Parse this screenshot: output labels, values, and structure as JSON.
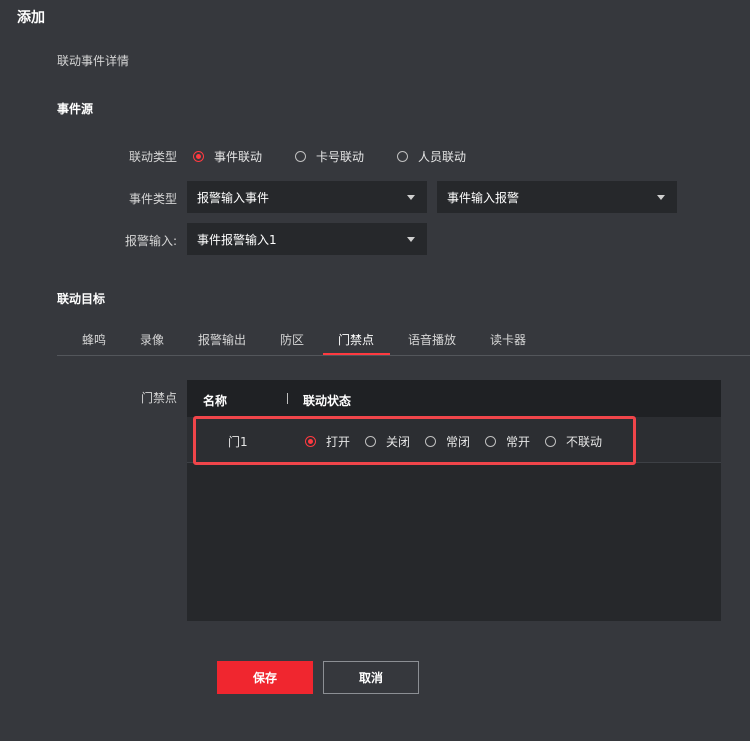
{
  "window": {
    "title": "添加",
    "subtitle": "联动事件详情"
  },
  "event_source": {
    "title": "事件源",
    "linkage_type": {
      "label": "联动类型",
      "options": [
        "事件联动",
        "卡号联动",
        "人员联动"
      ],
      "selected": "事件联动"
    },
    "event_type": {
      "label": "事件类型",
      "primary_value": "报警输入事件",
      "secondary_value": "事件输入报警"
    },
    "alarm_input": {
      "label": "报警输入:",
      "value": "事件报警输入1"
    }
  },
  "linkage_target": {
    "title": "联动目标",
    "tabs": [
      "蜂鸣",
      "录像",
      "报警输出",
      "防区",
      "门禁点",
      "语音播放",
      "读卡器"
    ],
    "active_tab": "门禁点",
    "access_point_label": "门禁点",
    "table": {
      "headers": [
        "名称",
        "联动状态"
      ],
      "rows": [
        {
          "name": "门1",
          "options": [
            "打开",
            "关闭",
            "常闭",
            "常开",
            "不联动"
          ],
          "selected": "打开"
        }
      ]
    }
  },
  "actions": {
    "save_label": "保存",
    "cancel_label": "取消"
  },
  "colors": {
    "background": "#36383d",
    "accent": "#f0262f",
    "highlight_border": "#f0454a"
  }
}
